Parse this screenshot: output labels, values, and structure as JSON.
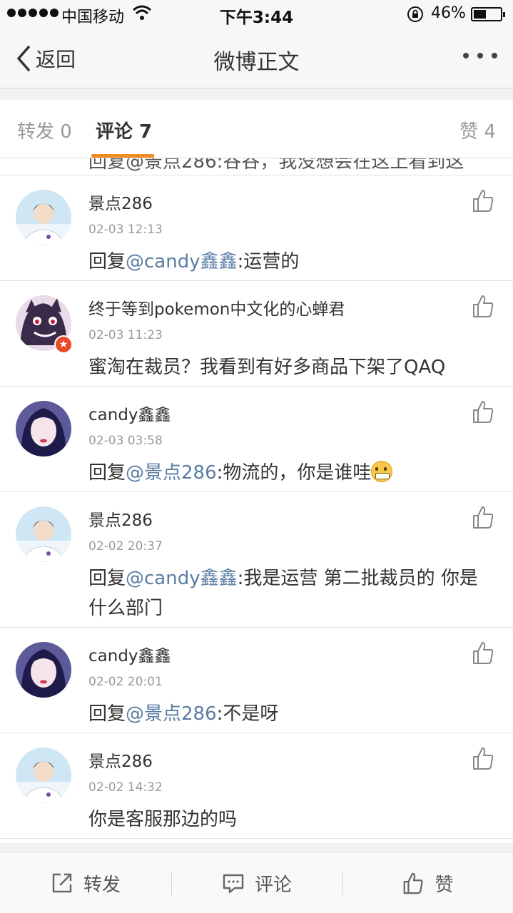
{
  "status_bar": {
    "carrier": "中国移动",
    "time": "下午3:44",
    "battery_percent_text": "46%",
    "battery_level": 0.46
  },
  "nav": {
    "back_label": "返回",
    "title": "微博正文"
  },
  "tabs": {
    "forward": "转发 0",
    "comments": "评论 7",
    "likes": "赞 4"
  },
  "partial_row_text": "回复@景点286:谷谷，我没想会在这上看到这",
  "comments": [
    {
      "user": "景点286",
      "time": "02-03 12:13",
      "prefix": "回复",
      "mention": "@candy鑫鑫",
      "text": ":运营的",
      "has_emoji": false
    },
    {
      "user": "终于等到pokemon中文化的心蝉君",
      "time": "02-03 11:23",
      "prefix": "",
      "mention": "",
      "text": "蜜淘在裁员？我看到有好多商品下架了QAQ",
      "has_emoji": false
    },
    {
      "user": "candy鑫鑫",
      "time": "02-03 03:58",
      "prefix": "回复",
      "mention": "@景点286",
      "text": ":物流的，你是谁哇",
      "has_emoji": true
    },
    {
      "user": "景点286",
      "time": "02-02 20:37",
      "prefix": "回复",
      "mention": "@candy鑫鑫",
      "text": ":我是运营 第二批裁员的 你是什么部门",
      "has_emoji": false
    },
    {
      "user": "candy鑫鑫",
      "time": "02-02 20:01",
      "prefix": "回复",
      "mention": "@景点286",
      "text": ":不是呀",
      "has_emoji": false
    },
    {
      "user": "景点286",
      "time": "02-02 14:32",
      "prefix": "",
      "mention": "",
      "text": "你是客服那边的吗",
      "has_emoji": false
    }
  ],
  "toolbar": {
    "forward": "转发",
    "comment": "评论",
    "like": "赞"
  },
  "icons": {
    "back": "chevron-left-icon",
    "more": "more-dots-icon",
    "like": "thumbs-up-icon",
    "forward": "share-icon",
    "comment": "comment-bubble-icon",
    "emoji": "grin-emoji-icon"
  },
  "colors": {
    "accent_underline": "#f08a24",
    "mention": "#5a7da3",
    "badge": "#e84a2a"
  }
}
